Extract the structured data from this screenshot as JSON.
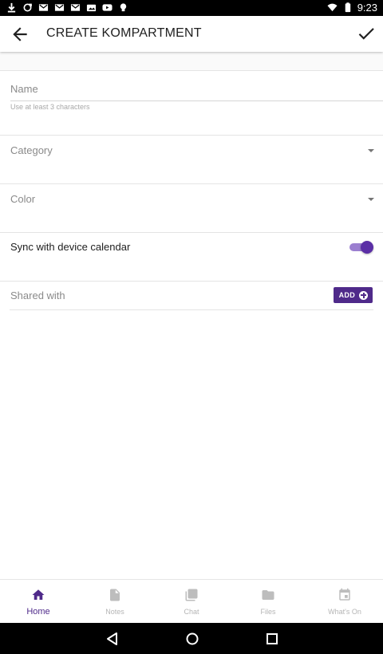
{
  "status_bar": {
    "time": "9:23",
    "left_icons": [
      "download-icon",
      "sync-icon",
      "gmail-icon",
      "gmail-icon",
      "gmail-icon",
      "photos-icon",
      "youtube-icon",
      "lightbulb-icon"
    ],
    "right_icons": [
      "wifi-icon",
      "battery-icon"
    ]
  },
  "app_bar": {
    "title": "CREATE KOMPARTMENT",
    "back_icon": "arrow-back-icon",
    "confirm_icon": "check-icon"
  },
  "form": {
    "name": {
      "placeholder": "Name",
      "value": "",
      "hint": "Use at least 3 characters"
    },
    "category": {
      "label": "Category"
    },
    "color": {
      "label": "Color"
    },
    "sync": {
      "label": "Sync with device calendar",
      "enabled": true
    },
    "shared": {
      "label": "Shared with",
      "add_label": "ADD"
    }
  },
  "bottom_nav": {
    "items": [
      {
        "label": "Home",
        "icon": "home-icon",
        "active": true
      },
      {
        "label": "Notes",
        "icon": "note-icon",
        "active": false
      },
      {
        "label": "Chat",
        "icon": "chat-icon",
        "active": false
      },
      {
        "label": "Files",
        "icon": "folder-icon",
        "active": false
      },
      {
        "label": "What's On",
        "icon": "calendar-icon",
        "active": false
      }
    ]
  },
  "colors": {
    "accent": "#4f2a8a",
    "toggle_thumb": "#5b2fa6",
    "toggle_track": "#9b7fd0"
  }
}
